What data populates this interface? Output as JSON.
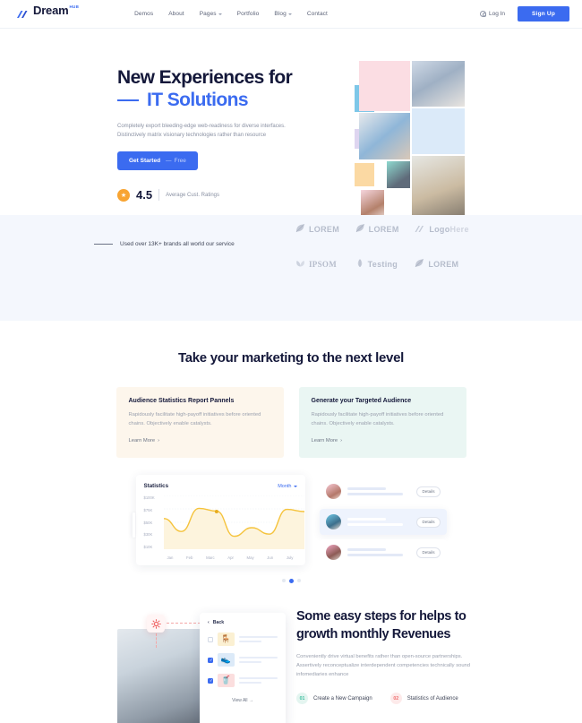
{
  "header": {
    "logo": {
      "name": "Dream",
      "sup": "HUB",
      "icon": "slashes-logo-icon"
    },
    "nav": [
      {
        "label": "Demos",
        "dropdown": false
      },
      {
        "label": "About",
        "dropdown": false
      },
      {
        "label": "Pages",
        "dropdown": true
      },
      {
        "label": "Portfolio",
        "dropdown": false
      },
      {
        "label": "Blog",
        "dropdown": true
      },
      {
        "label": "Contact",
        "dropdown": false
      }
    ],
    "login_label": "Log In",
    "login_icon": "user-circle-icon",
    "signup_label": "Sign Up",
    "accent": "#3b6bf0"
  },
  "hero": {
    "title_line1": "New Experiences for",
    "title_line2": "IT Solutions",
    "paragraph": "Completely export bleeding-edge web-readiness for diverse interfaces. Distinctively matrix visionary technologies rather than resource",
    "cta_label": "Get Started",
    "cta_sub": "Free",
    "cta_dash": "—",
    "rating_value": "4.5",
    "rating_caption": "Average Cust. Ratings",
    "rating_icon": "star-icon"
  },
  "brands": {
    "tagline": "Used over 13K+ brands all world our service",
    "items": [
      {
        "name": "LOREM",
        "icon": "leaf-icon",
        "style": "sans"
      },
      {
        "name": "LOREM",
        "icon": "leaf-icon",
        "style": "sans"
      },
      {
        "name": "Logo",
        "name2": "Here",
        "icon": "slashes-logo-icon",
        "style": "sans"
      },
      {
        "name": "IPSOM",
        "icon": "fan-icon",
        "style": "serif"
      },
      {
        "name": "Testing",
        "icon": "sprout-icon",
        "style": "sans"
      },
      {
        "name": "LOREM",
        "icon": "leaf-icon",
        "style": "sans"
      }
    ]
  },
  "marketing": {
    "title": "Take your marketing to the next level",
    "cards": [
      {
        "title": "Audience Statistics Report Pannels",
        "body": "Rapidously facilitate high-payoff initiatives before oriented chains. Objectively enable catalysts.",
        "link": "Learn More",
        "arrow": "›"
      },
      {
        "title": "Generate your Targeted Audience",
        "body": "Rapidously facilitate high-payoff initiatives before oriented chains. Objectively enable catalysts.",
        "link": "Learn More",
        "arrow": "›"
      }
    ]
  },
  "chart_data": {
    "type": "line",
    "title": "Statistics",
    "select_label": "Month",
    "categories": [
      "Jan",
      "Feb",
      "Marc",
      "Apr",
      "May",
      "Jun",
      "July"
    ],
    "x": [
      "Jan",
      "Feb",
      "Marc",
      "Apr",
      "May",
      "Jun",
      "July"
    ],
    "values": [
      57,
      33,
      76,
      71,
      24,
      40,
      28,
      74,
      70
    ],
    "ylabels": [
      "$100K",
      "$75K",
      "$50K",
      "$30K",
      "$10K"
    ],
    "ylim": [
      0,
      100
    ],
    "ytick_values": [
      100,
      75,
      50,
      30,
      10
    ],
    "series": [
      {
        "name": "Revenue",
        "values": [
          57,
          33,
          76,
          71,
          24,
          40,
          28,
          74,
          70
        ]
      }
    ],
    "highlight_point": {
      "x": "Marc",
      "y": 70
    },
    "line_color": "#f5c33c",
    "fill_color": "#fdf4dd",
    "grid": true,
    "legend": "none",
    "xlabel": "",
    "ylabel": ""
  },
  "audience_list": {
    "rows": [
      {
        "details_label": "Details",
        "active": false
      },
      {
        "details_label": "Details",
        "active": true
      },
      {
        "details_label": "Details",
        "active": false
      }
    ]
  },
  "carousel": {
    "dots": 3,
    "active_index": 1
  },
  "steps": {
    "title_line1": "Some easy steps for helps to",
    "title_line2": "growth monthly Revenues",
    "paragraph": "Conveniently drive virtual benefits rather than open-source partnerships. Assertively reconceptualize interdependent competencies technically sound infomediaries enhance",
    "items": [
      {
        "num": "01",
        "label": "Create a New Campaign"
      },
      {
        "num": "02",
        "label": "Statistics of Audience"
      }
    ],
    "mini_card": {
      "back_label": "Back",
      "back_icon": "chevron-left-icon",
      "view_all": "View All  →",
      "rows": [
        {
          "checked": false,
          "thumb": "chair-icon"
        },
        {
          "checked": true,
          "thumb": "shoe-icon"
        },
        {
          "checked": true,
          "thumb": "cup-icon"
        }
      ]
    },
    "gear_icon": "gear-icon"
  }
}
